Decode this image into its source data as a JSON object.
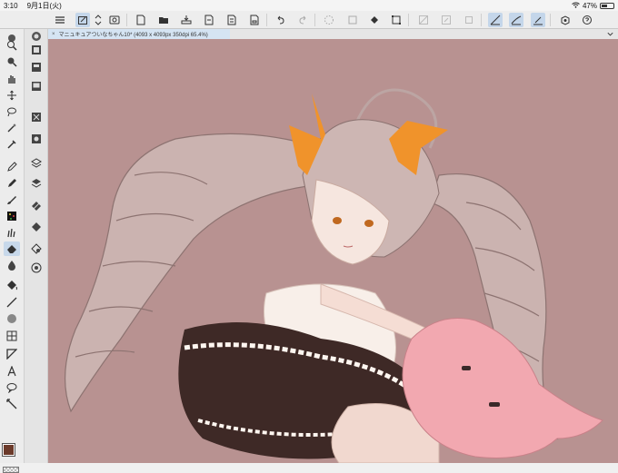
{
  "status": {
    "time": "3:10",
    "date": "9月1日(火)",
    "battery": "47%",
    "battery_level": 0.47
  },
  "document": {
    "tab_title": "マニュキュアついなちゃん10* (4093 x 4093px 350dpi 65.4%)"
  },
  "colors": {
    "main": "#6b3a2a",
    "canvas_bg": "#b89291",
    "toolbar_bg": "#ededed",
    "accent": "#c4d6ea"
  },
  "toolbar": {
    "items": [
      "menu-icon",
      "select-layer-icon",
      "swap-icon",
      "preview-icon",
      "new-icon",
      "open-icon",
      "save-icon",
      "export-icon",
      "export2-icon",
      "export3-icon",
      "undo-icon",
      "redo-icon",
      "loading-icon",
      "fill-icon",
      "transform-icon",
      "disabled1-icon",
      "disabled2-icon",
      "disabled3-icon",
      "ruler1-icon",
      "ruler2-icon",
      "ruler3-icon",
      "settings-icon",
      "help-icon"
    ]
  },
  "left_tools": [
    "circle-icon",
    "zoom-icon",
    "zoom-move-icon",
    "hand-icon",
    "move-icon",
    "lasso-icon",
    "magic-wand-icon",
    "eyedropper-icon",
    "pen-icon",
    "pencil-icon",
    "brush-icon",
    "airbrush-icon",
    "decoration-icon",
    "eraser-icon",
    "blend-icon",
    "fill-bucket-icon",
    "gradient-icon",
    "figure-icon",
    "frame-icon",
    "ruler-icon",
    "text-icon",
    "balloon-icon",
    "line-correction-icon"
  ],
  "sub_tools": [
    "nav-icon",
    "tool-property-icon",
    "brush-size-icon",
    "color-wheel-icon",
    "color-set-icon",
    "approx-color-icon",
    "layer-icon",
    "layer-property-icon",
    "history-icon",
    "material-icon",
    "search-layer-icon",
    "sub-view-icon",
    "info-icon"
  ]
}
